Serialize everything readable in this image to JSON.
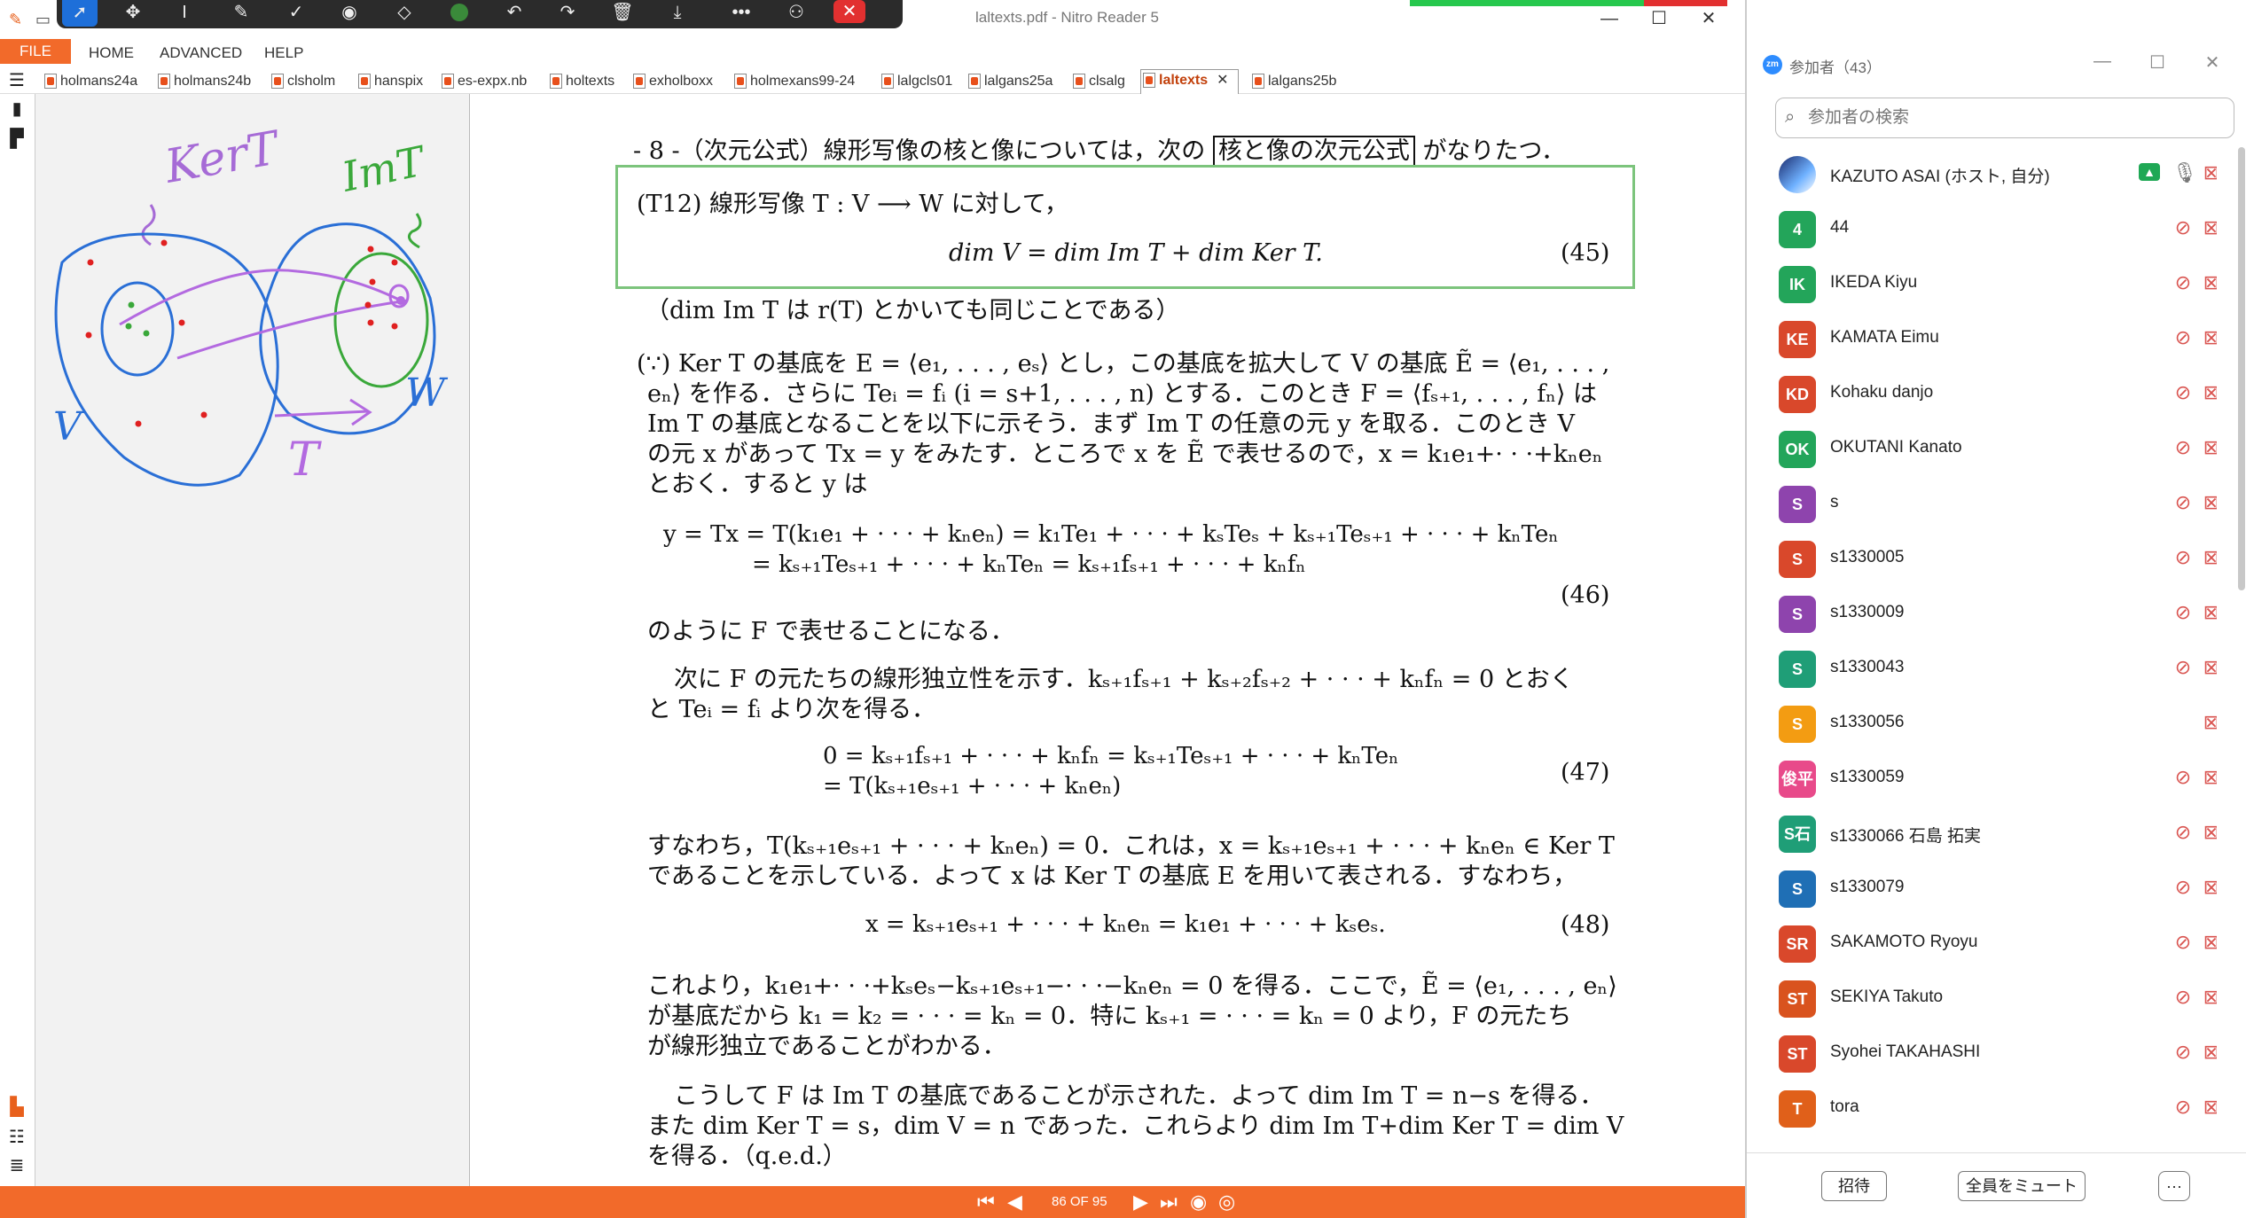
{
  "window": {
    "title": "laltexts.pdf - Nitro Reader 5",
    "minimize": "—",
    "maximize": "☐",
    "close": "✕"
  },
  "annotation_toolbar": {
    "tools": [
      "pointer-icon",
      "move-icon",
      "text-cursor-icon",
      "pen-icon",
      "check-icon",
      "stamp-icon",
      "eraser-icon",
      "color-dot-icon",
      "undo-icon",
      "redo-icon",
      "trash-icon",
      "download-icon",
      "more-icon",
      "share-icon",
      "close-icon"
    ]
  },
  "menu": {
    "file": "FILE",
    "home": "HOME",
    "advanced": "ADVANCED",
    "help": "HELP"
  },
  "tabs": [
    "holmans24a",
    "holmans24b",
    "clsholm",
    "hanspix",
    "es-expx.nb",
    "holtexts",
    "exholboxx",
    "holmexans99-24",
    "lalgcls01",
    "lalgans25a",
    "clsalg",
    "laltexts",
    "lalgans25b"
  ],
  "active_tab": "laltexts",
  "active_tab_close": "✕",
  "handwriting": {
    "ker": "KerT",
    "im": "ImT",
    "v": "V",
    "w": "W",
    "t": "T"
  },
  "doc": {
    "header_pre": "- 8 -（次元公式）線形写像の核と像については，次の",
    "header_box": "核と像の次元公式",
    "header_post": "がなりたつ．",
    "t12": "(T12)  線形写像 T : V ⟶ W に対して，",
    "eq45": "dim V = dim Im T + dim Ker T.",
    "eq45_no": "(45)",
    "note": "（dim Im T は r(T) とかいても同じことである）",
    "p1_l1": "(∵) Ker T の基底を E = ⟨e₁, . . . , eₛ⟩ とし，この基底を拡大して V の基底 Ẽ = ⟨e₁, . . . ,",
    "p1_l2": "eₙ⟩ を作る．さらに Teᵢ = fᵢ (i = s+1, . . . , n) とする．このとき F = ⟨fₛ₊₁, . . . , fₙ⟩ は",
    "p1_l3": "Im T の基底となることを以下に示そう．まず Im T の任意の元 y を取る．このとき V",
    "p1_l4": "の元 x があって Tx = y をみたす．ところで x を Ẽ で表せるので，x = k₁e₁+· · ·+kₙeₙ",
    "p1_l5": "とおく．すると y は",
    "eq46_l1": "y = Tx = T(k₁e₁ + · · · + kₙeₙ) = k₁Te₁ + · · · + kₛTeₛ + kₛ₊₁Teₛ₊₁ + · · · + kₙTeₙ",
    "eq46_l2": "= kₛ₊₁Teₛ₊₁ + · · · + kₙTeₙ = kₛ₊₁fₛ₊₁ + · · · + kₙfₙ",
    "eq46_no": "(46)",
    "p2": "のように F で表せることになる．",
    "p3_l1": "次に F の元たちの線形独立性を示す．kₛ₊₁fₛ₊₁ + kₛ₊₂fₛ₊₂ + · · · + kₙfₙ = 0 とおく",
    "p3_l2": "と Teᵢ = fᵢ より次を得る．",
    "eq47_l1": "0 = kₛ₊₁fₛ₊₁ + · · · + kₙfₙ = kₛ₊₁Teₛ₊₁ + · · · + kₙTeₙ",
    "eq47_l2": "= T(kₛ₊₁eₛ₊₁ + · · · + kₙeₙ)",
    "eq47_no": "(47)",
    "p4_l1": "すなわち，T(kₛ₊₁eₛ₊₁ + · · · + kₙeₙ) = 0．これは，x = kₛ₊₁eₛ₊₁ + · · · + kₙeₙ ∈ Ker T",
    "p4_l2": "であることを示している．よって x は Ker T の基底 E を用いて表される．すなわち，",
    "eq48": "x = kₛ₊₁eₛ₊₁ + · · · + kₙeₙ = k₁e₁ + · · · + kₛeₛ.",
    "eq48_no": "(48)",
    "p5_l1": "これより，k₁e₁+· · ·+kₛeₛ−kₛ₊₁eₛ₊₁−· · ·−kₙeₙ = 0 を得る．ここで，Ẽ = ⟨e₁, . . . , eₙ⟩",
    "p5_l2": "が基底だから k₁ = k₂ = · · · = kₙ = 0．特に kₛ₊₁ = · · · = kₙ = 0 より，F の元たち",
    "p5_l3": "が線形独立であることがわかる．",
    "p6_l1": "こうして F は Im T の基底であることが示された．よって dim Im T = n−s を得る．",
    "p6_l2": "また dim Ker T = s，dim V = n であった．これらより dim Im T+dim Ker T = dim V",
    "p6_l3": "を得る．（q.e.d.）"
  },
  "status": {
    "page": "86 OF 95"
  },
  "zoom": {
    "title": "参加者（43）",
    "search_placeholder": "参加者の検索",
    "participants": [
      {
        "initials": "",
        "name": "KAZUTO ASAI (ホスト, 自分)",
        "color": "#ffffff",
        "host": true
      },
      {
        "initials": "4",
        "name": "44",
        "color": "#23a55a"
      },
      {
        "initials": "IK",
        "name": "IKEDA Kiyu",
        "color": "#23a55a"
      },
      {
        "initials": "KE",
        "name": "KAMATA Eimu",
        "color": "#d9482b"
      },
      {
        "initials": "KD",
        "name": "Kohaku danjo",
        "color": "#d9482b"
      },
      {
        "initials": "OK",
        "name": "OKUTANI Kanato",
        "color": "#23a55a"
      },
      {
        "initials": "S",
        "name": "s",
        "color": "#8e44ad"
      },
      {
        "initials": "S",
        "name": "s1330005",
        "color": "#d9482b"
      },
      {
        "initials": "S",
        "name": "s1330009",
        "color": "#8e44ad"
      },
      {
        "initials": "S",
        "name": "s1330043",
        "color": "#1f9e77"
      },
      {
        "initials": "S",
        "name": "s1330056",
        "color": "#f39c12",
        "no_mic": true
      },
      {
        "initials": "俊平",
        "name": "s1330059",
        "color": "#e84a8a"
      },
      {
        "initials": "S石",
        "name": "s1330066 石島 拓実",
        "color": "#1f9e77"
      },
      {
        "initials": "S",
        "name": "s1330079",
        "color": "#1f6fb5"
      },
      {
        "initials": "SR",
        "name": "SAKAMOTO Ryoyu",
        "color": "#d9482b"
      },
      {
        "initials": "ST",
        "name": "SEKIYA Takuto",
        "color": "#d9531e"
      },
      {
        "initials": "ST",
        "name": "Syohei TAKAHASHI",
        "color": "#d9482b"
      },
      {
        "initials": "T",
        "name": "tora",
        "color": "#e0601a"
      }
    ],
    "invite": "招待",
    "mute_all": "全員をミュート",
    "more": "···"
  }
}
